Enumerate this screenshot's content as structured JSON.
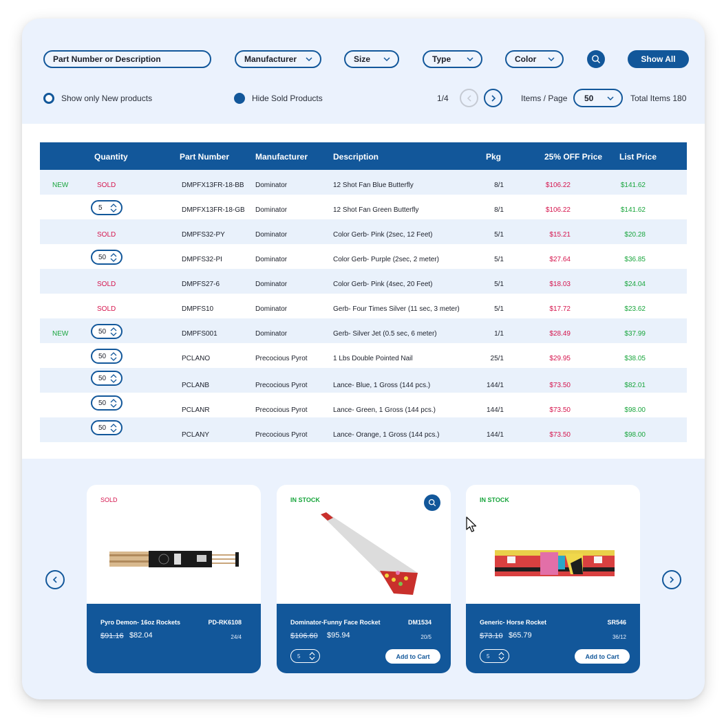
{
  "filters": {
    "search_placeholder": "Part Number or Description",
    "dropdowns": [
      {
        "label": "Manufacturer"
      },
      {
        "label": "Size"
      },
      {
        "label": "Type"
      },
      {
        "label": "Color"
      }
    ],
    "search_icon": "search-icon",
    "show_all_label": "Show All",
    "show_new_label": "Show only New products",
    "show_new_checked": false,
    "hide_sold_label": "Hide Sold Products",
    "hide_sold_checked": true
  },
  "pagination": {
    "page_indicator": "1/4",
    "prev_icon": "chevron-left-icon",
    "next_icon": "chevron-right-icon",
    "items_per_page_label": "Items / Page",
    "items_per_page_value": "50",
    "total_items_label": "Total Items 180"
  },
  "table": {
    "headers": {
      "tag": "",
      "quantity": "Quantity",
      "part_number": "Part Number",
      "manufacturer": "Manufacturer",
      "description": "Description",
      "pkg": "Pkg",
      "sale_price": "25% OFF Price",
      "list_price": "List Price"
    },
    "rows": [
      {
        "tag": "NEW",
        "status": "SOLD",
        "qty": null,
        "part": "DMPFX13FR-18-BB",
        "mfr": "Dominator",
        "desc": "12 Shot Fan Blue Butterfly",
        "pkg": "8/1",
        "sale": "$106.22",
        "list": "$141.62"
      },
      {
        "tag": "",
        "status": "",
        "qty": "5",
        "part": "DMPFX13FR-18-GB",
        "mfr": "Dominator",
        "desc": "12 Shot Fan Green Butterfly",
        "pkg": "8/1",
        "sale": "$106.22",
        "list": "$141.62"
      },
      {
        "tag": "",
        "status": "SOLD",
        "qty": null,
        "part": "DMPFS32-PY",
        "mfr": "Dominator",
        "desc": "Color Gerb- Pink (2sec, 12 Feet)",
        "pkg": "5/1",
        "sale": "$15.21",
        "list": "$20.28"
      },
      {
        "tag": "",
        "status": "",
        "qty": "50",
        "part": "DMPFS32-PI",
        "mfr": "Dominator",
        "desc": "Color Gerb- Purple (2sec, 2 meter)",
        "pkg": "5/1",
        "sale": "$27.64",
        "list": "$36.85"
      },
      {
        "tag": "",
        "status": "SOLD",
        "qty": null,
        "part": "DMPFS27-6",
        "mfr": "Dominator",
        "desc": "Color Gerb- Pink (4sec, 20 Feet)",
        "pkg": "5/1",
        "sale": "$18.03",
        "list": "$24.04"
      },
      {
        "tag": "",
        "status": "SOLD",
        "qty": null,
        "part": "DMPFS10",
        "mfr": "Dominator",
        "desc": "Gerb- Four Times Silver (11 sec, 3 meter)",
        "pkg": "5/1",
        "sale": "$17.72",
        "list": "$23.62"
      },
      {
        "tag": "NEW",
        "status": "",
        "qty": "50",
        "part": "DMPFS001",
        "mfr": "Dominator",
        "desc": "Gerb- Silver Jet (0.5 sec, 6 meter)",
        "pkg": "1/1",
        "sale": "$28.49",
        "list": "$37.99"
      },
      {
        "tag": "",
        "status": "",
        "qty": "50",
        "part": "PCLANO",
        "mfr": "Precocious Pyrot",
        "desc": "1 Lbs Double Pointed Nail",
        "pkg": "25/1",
        "sale": "$29.95",
        "list": "$38.05"
      },
      {
        "tag": "",
        "status": "",
        "qty": "50",
        "part": "PCLANB",
        "mfr": "Precocious Pyrot",
        "desc": "Lance- Blue, 1 Gross (144 pcs.)",
        "pkg": "144/1",
        "sale": "$73.50",
        "list": "$82.01"
      },
      {
        "tag": "",
        "status": "",
        "qty": "50",
        "part": "PCLANR",
        "mfr": "Precocious Pyrot",
        "desc": "Lance- Green, 1 Gross (144 pcs.)",
        "pkg": "144/1",
        "sale": "$73.50",
        "list": "$98.00"
      },
      {
        "tag": "",
        "status": "",
        "qty": "50",
        "part": "PCLANY",
        "mfr": "Precocious Pyrot",
        "desc": "Lance- Orange, 1 Gross (144 pcs.)",
        "pkg": "144/1",
        "sale": "$73.50",
        "list": "$98.00"
      }
    ]
  },
  "carousel": {
    "prev_icon": "chevron-left-icon",
    "next_icon": "chevron-right-icon",
    "cards": [
      {
        "status": "SOLD",
        "name": "Pyro Demon- 16oz Rockets",
        "sku": "PD-RK6108",
        "old_price": "$91.16",
        "price": "$82.04",
        "pack": "24/4",
        "qty": null,
        "cart_label": null
      },
      {
        "status": "IN STOCK",
        "name": "Dominator-Funny Face Rocket",
        "sku": "DM1534",
        "old_price": "$106.60",
        "price": "$95.94",
        "pack": "20/5",
        "qty": "5",
        "cart_label": "Add to Cart"
      },
      {
        "status": "IN STOCK",
        "name": "Generic- Horse Rocket",
        "sku": "SR546",
        "old_price": "$73.10",
        "price": "$65.79",
        "pack": "36/12",
        "qty": "5",
        "cart_label": "Add to Cart"
      }
    ]
  },
  "colors": {
    "primary": "#12579a",
    "sold_red": "#d5134c",
    "new_green": "#18a53c",
    "page_bg": "#ebf2fd"
  }
}
